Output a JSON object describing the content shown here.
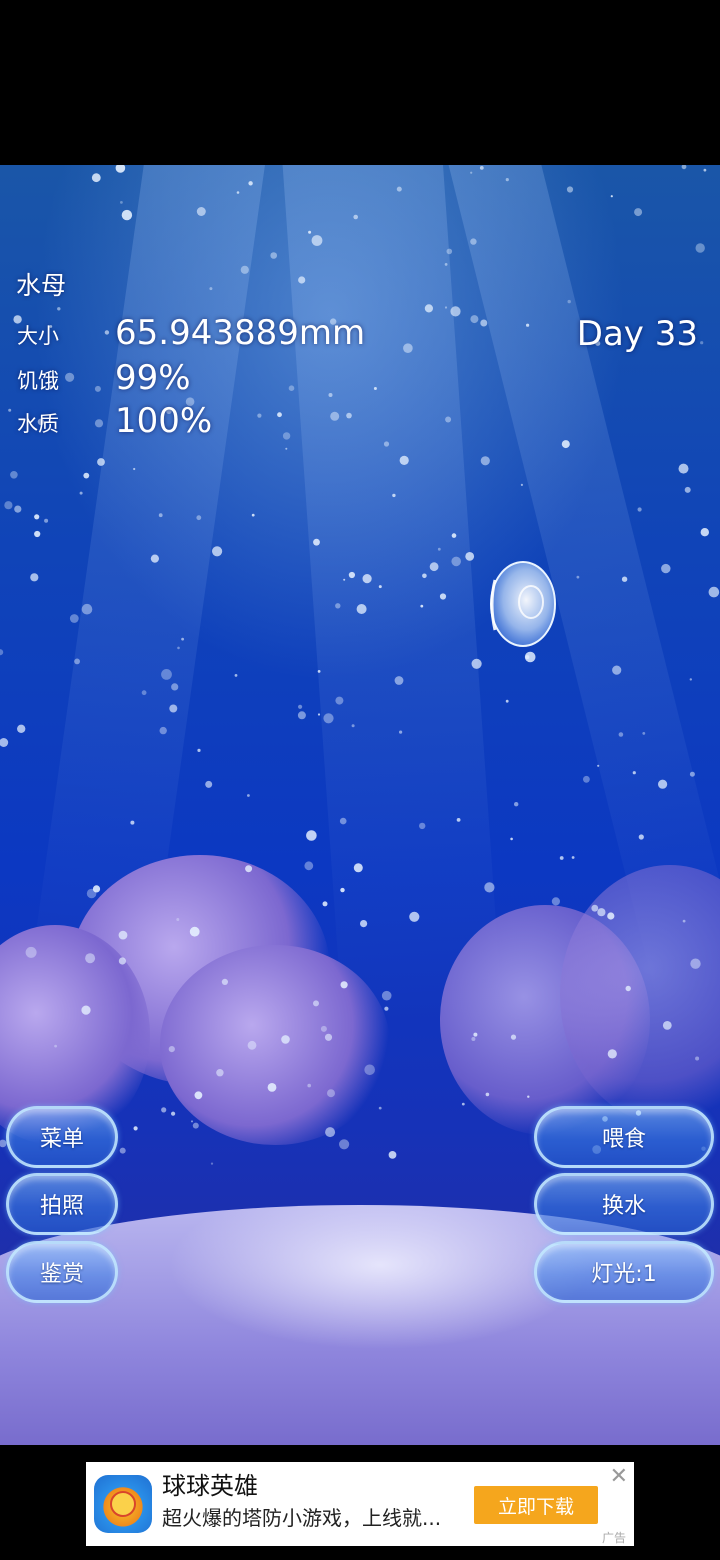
{
  "hud": {
    "title": "水母",
    "size_label": "大小",
    "size_value": "65.943889mm",
    "hunger_label": "饥饿",
    "hunger_value": "99%",
    "water_label": "水质",
    "water_value": "100%",
    "day": "Day 33"
  },
  "buttons": {
    "menu": "菜单",
    "photo": "拍照",
    "appreciate": "鉴赏",
    "feed": "喂食",
    "change_water": "换水",
    "light": "灯光:1"
  },
  "ad": {
    "title": "球球英雄",
    "description": "超火爆的塔防小游戏，上线就...",
    "cta": "立即下载",
    "close": "✕",
    "tag": "广告"
  },
  "icons": {
    "jellyfish": "jellyfish-icon",
    "ad_app": "game-app-icon"
  },
  "colors": {
    "water_top": "#1a56a8",
    "water_bottom": "#2a2a9a",
    "cta": "#f5a61d"
  }
}
